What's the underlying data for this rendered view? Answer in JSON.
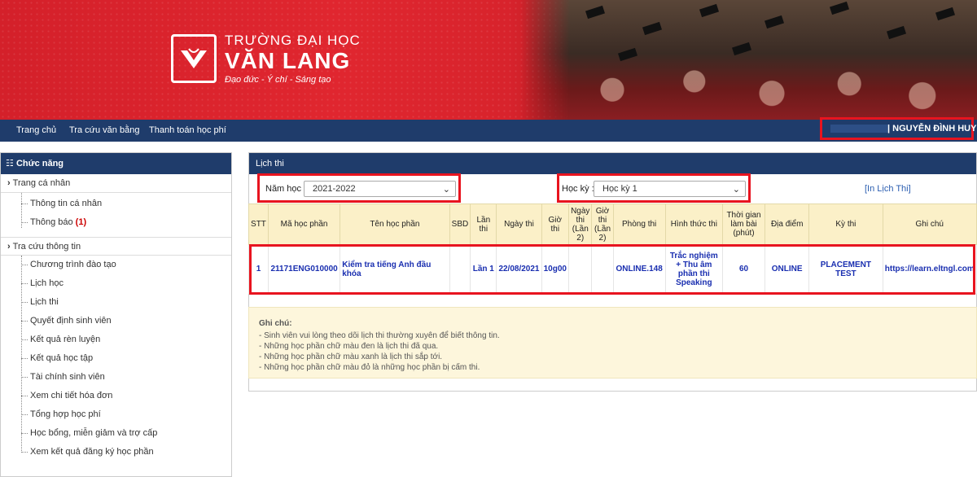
{
  "school": {
    "line1": "TRƯỜNG ĐẠI HỌC",
    "line2": "VĂN LANG",
    "slogan": "Đạo đức - Ý chí - Sáng tạo"
  },
  "nav": {
    "items": [
      "Trang chủ",
      "Tra cứu văn bằng",
      "Thanh toán học phí"
    ],
    "user_name": "| NGUYỄN ĐÌNH HUY ▾"
  },
  "sidebar": {
    "title": "Chức năng",
    "group1": "Trang cá nhân",
    "group1_items": [
      "Thông tin cá nhân",
      "Thông báo"
    ],
    "notify_count": "(1)",
    "group2": "Tra cứu thông tin",
    "group2_items": [
      "Chương trình đào tạo",
      "Lịch học",
      "Lịch thi",
      "Quyết định sinh viên",
      "Kết quả rèn luyện",
      "Kết quả học tập",
      "Tài chính sinh viên",
      "Xem chi tiết hóa đơn",
      "Tổng hợp học phí",
      "Học bổng, miễn giảm và trợ cấp",
      "Xem kết quả đăng ký học phần"
    ]
  },
  "panel": {
    "title": "Lịch thi",
    "year_label": "Năm học :",
    "year_value": "2021-2022",
    "term_label": "Học kỳ :",
    "term_value": "Học kỳ 1",
    "print_link": "[In Lịch Thi]"
  },
  "table": {
    "headers": [
      "STT",
      "Mã học phần",
      "Tên học phần",
      "SBD",
      "Lần thi",
      "Ngày thi",
      "Giờ thi",
      "Ngày thi (Lần 2)",
      "Giờ thi (Lần 2)",
      "Phòng thi",
      "Hình thức thi",
      "Thời gian làm bài (phút)",
      "Địa điểm",
      "Kỳ thi",
      "Ghi chú"
    ],
    "row": {
      "stt": "1",
      "code": "21171ENG010000",
      "name": "Kiểm tra tiếng Anh đầu khóa",
      "sbd": "",
      "attempt": "Lần 1",
      "date": "22/08/2021",
      "time": "10g00",
      "date2": "",
      "time2": "",
      "room": "ONLINE.148",
      "form": "Trắc nghiệm + Thu âm phần thi Speaking",
      "duration": "60",
      "place": "ONLINE",
      "exam": "PLACEMENT TEST",
      "note": "https://learn.eltngl.com"
    }
  },
  "notes": {
    "title": "Ghi chú:",
    "lines": [
      "- Sinh viên vui lòng theo dõi lịch thi thường xuyên để biết thông tin.",
      "- Những học phần chữ màu đen là lịch thi đã qua.",
      "- Những học phần chữ màu xanh là lịch thi sắp tới.",
      "- Những học phần chữ màu đỏ là những học phần bị cấm thi."
    ]
  },
  "colors": {
    "brand_red": "#d4202a",
    "nav_blue": "#1f3c6b",
    "highlight": "#e8141f",
    "upcoming_text": "#1a2fb0"
  }
}
